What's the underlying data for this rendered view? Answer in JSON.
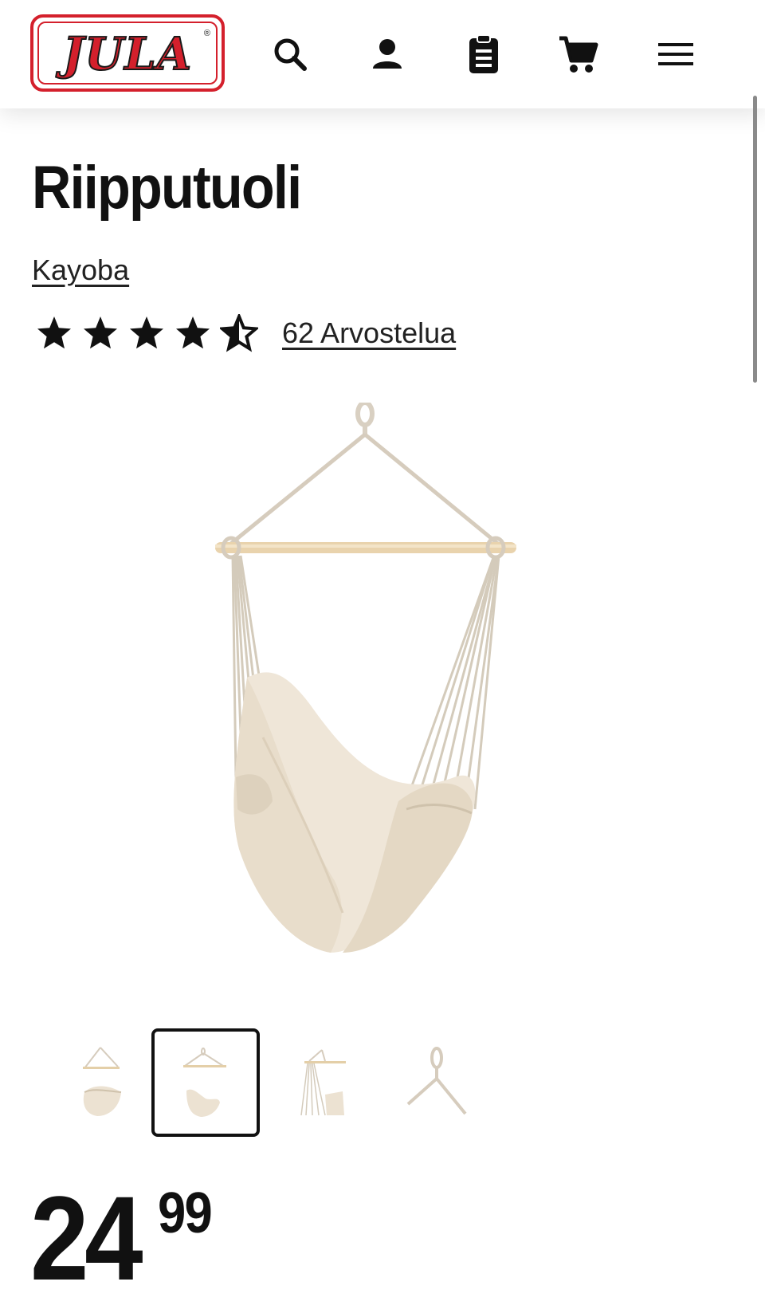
{
  "header": {
    "logo_text": "JULA",
    "logo_registered": "®",
    "icons": [
      "search-icon",
      "account-icon",
      "shopping-list-icon",
      "cart-icon",
      "menu-icon"
    ],
    "brand_color": "#d4202c"
  },
  "product": {
    "title": "Riipputuoli",
    "brand": "Kayoba",
    "rating": 4.5,
    "rating_max": 5,
    "reviews_label": "62 Arvostelua",
    "thumbnails": [
      "thumbnail-1",
      "thumbnail-2",
      "thumbnail-3",
      "thumbnail-4"
    ],
    "selected_thumbnail": 2,
    "price_integer": "24",
    "price_decimal": "99"
  }
}
